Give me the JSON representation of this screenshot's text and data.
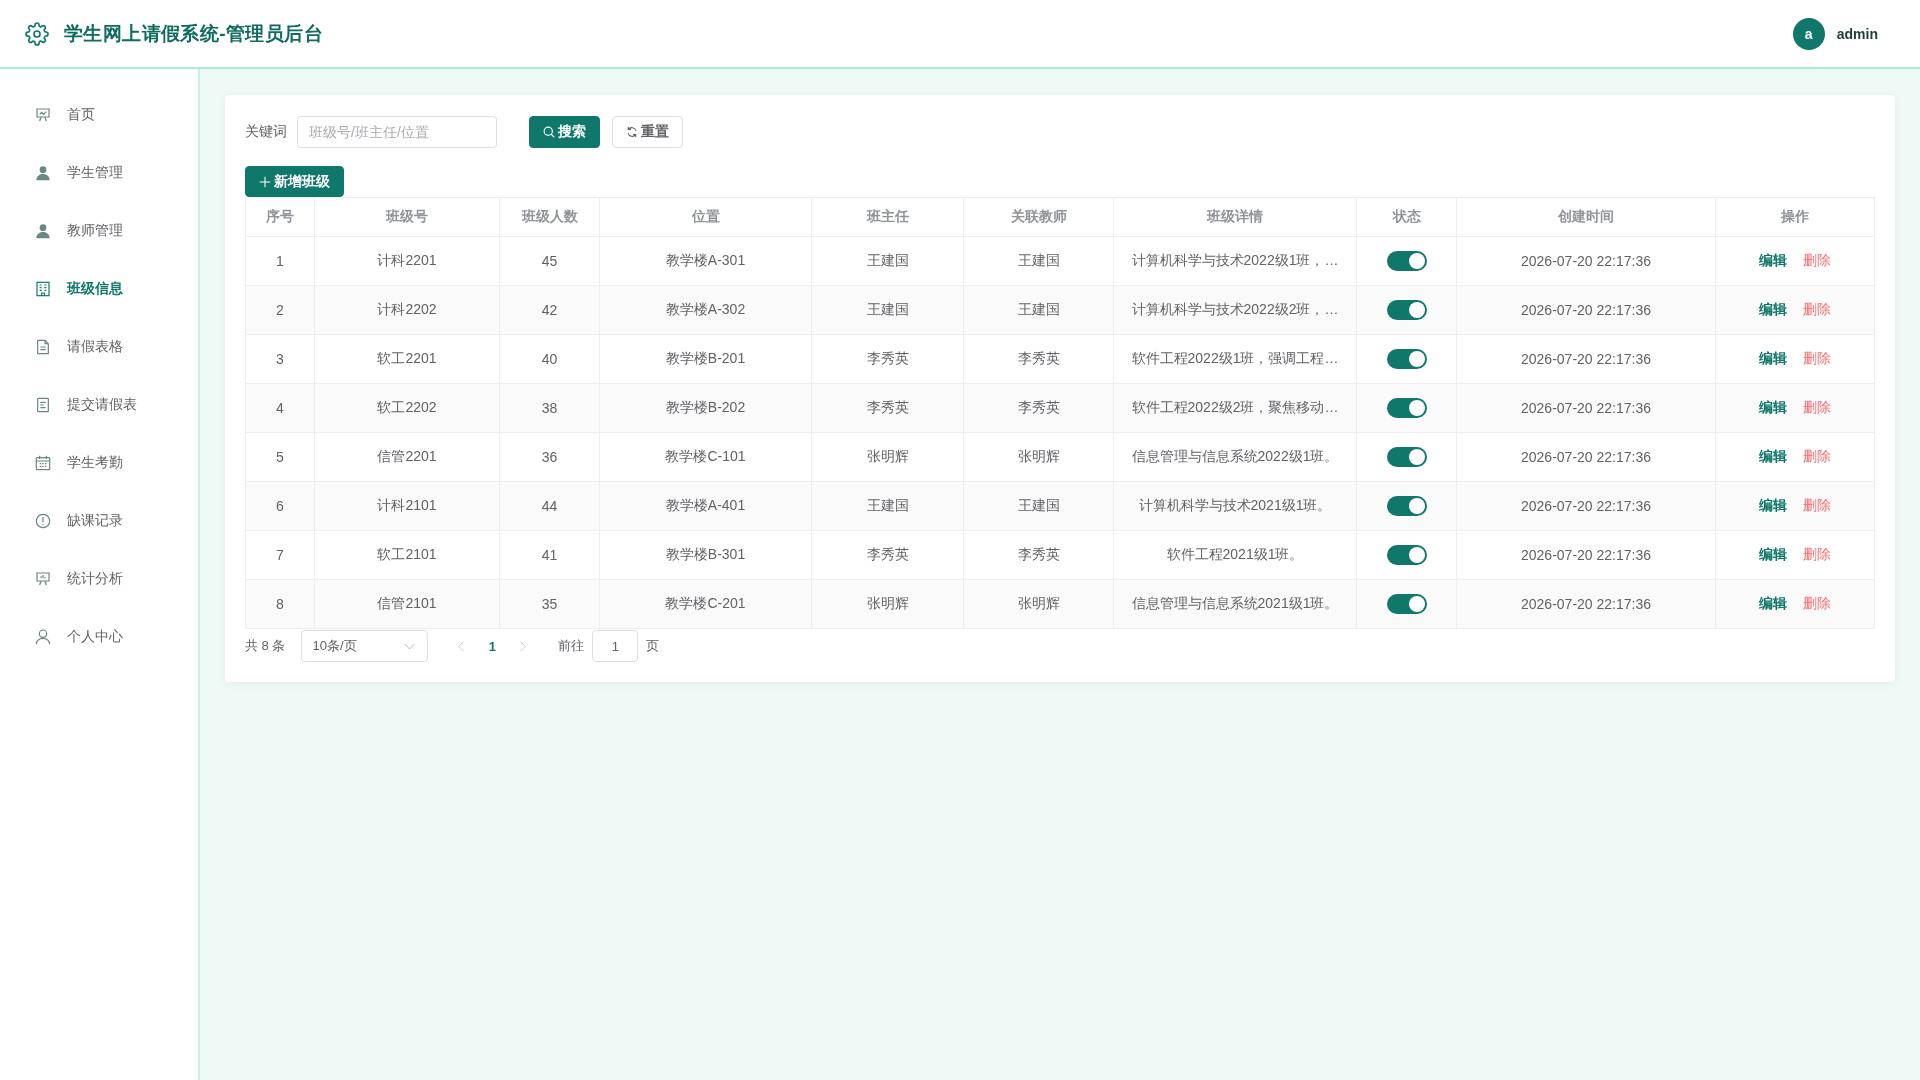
{
  "header": {
    "title": "学生网上请假系统-管理员后台",
    "user": {
      "avatar_letter": "a",
      "name": "admin"
    }
  },
  "sidebar": {
    "items": [
      {
        "label": "首页",
        "selected": false
      },
      {
        "label": "学生管理",
        "selected": false
      },
      {
        "label": "教师管理",
        "selected": false
      },
      {
        "label": "班级信息",
        "selected": true
      },
      {
        "label": "请假表格",
        "selected": false
      },
      {
        "label": "提交请假表",
        "selected": false
      },
      {
        "label": "学生考勤",
        "selected": false
      },
      {
        "label": "缺课记录",
        "selected": false
      },
      {
        "label": "统计分析",
        "selected": false
      },
      {
        "label": "个人中心",
        "selected": false
      }
    ]
  },
  "toolbar": {
    "keyword_label": "关键词",
    "search_field": {
      "placeholder": "班级号/班主任/位置"
    },
    "search_button": "搜索",
    "reset_button": "重置",
    "add_button": "新增班级"
  },
  "table": {
    "columns": [
      "序号",
      "班级号",
      "班级人数",
      "位置",
      "班主任",
      "关联教师",
      "班级详情",
      "状态",
      "创建时间",
      "操作"
    ],
    "rows": [
      {
        "index": "1",
        "class_no": "计科2201",
        "size": "45",
        "location": "教学楼A-301",
        "head_teacher": "王建国",
        "teacher": "王建国",
        "details": "计算机科学与技术2022级1班，…",
        "status_on": true,
        "created": "2026-07-20 22:17:36",
        "actions": [
          {
            "kind": "edit",
            "label": "编辑"
          },
          {
            "kind": "delete",
            "label": "删除"
          }
        ]
      },
      {
        "index": "2",
        "class_no": "计科2202",
        "size": "42",
        "location": "教学楼A-302",
        "head_teacher": "王建国",
        "teacher": "王建国",
        "details": "计算机科学与技术2022级2班，…",
        "status_on": true,
        "created": "2026-07-20 22:17:36",
        "actions": [
          {
            "kind": "edit",
            "label": "编辑"
          },
          {
            "kind": "delete",
            "label": "删除"
          }
        ]
      },
      {
        "index": "3",
        "class_no": "软工2201",
        "size": "40",
        "location": "教学楼B-201",
        "head_teacher": "李秀英",
        "teacher": "李秀英",
        "details": "软件工程2022级1班，强调工程…",
        "status_on": true,
        "created": "2026-07-20 22:17:36",
        "actions": [
          {
            "kind": "edit",
            "label": "编辑"
          },
          {
            "kind": "delete",
            "label": "删除"
          }
        ]
      },
      {
        "index": "4",
        "class_no": "软工2202",
        "size": "38",
        "location": "教学楼B-202",
        "head_teacher": "李秀英",
        "teacher": "李秀英",
        "details": "软件工程2022级2班，聚焦移动…",
        "status_on": true,
        "created": "2026-07-20 22:17:36",
        "actions": [
          {
            "kind": "edit",
            "label": "编辑"
          },
          {
            "kind": "delete",
            "label": "删除"
          }
        ]
      },
      {
        "index": "5",
        "class_no": "信管2201",
        "size": "36",
        "location": "教学楼C-101",
        "head_teacher": "张明辉",
        "teacher": "张明辉",
        "details": "信息管理与信息系统2022级1班。",
        "status_on": true,
        "created": "2026-07-20 22:17:36",
        "actions": [
          {
            "kind": "edit",
            "label": "编辑"
          },
          {
            "kind": "delete",
            "label": "删除"
          }
        ]
      },
      {
        "index": "6",
        "class_no": "计科2101",
        "size": "44",
        "location": "教学楼A-401",
        "head_teacher": "王建国",
        "teacher": "王建国",
        "details": "计算机科学与技术2021级1班。",
        "status_on": true,
        "created": "2026-07-20 22:17:36",
        "actions": [
          {
            "kind": "edit",
            "label": "编辑"
          },
          {
            "kind": "delete",
            "label": "删除"
          }
        ]
      },
      {
        "index": "7",
        "class_no": "软工2101",
        "size": "41",
        "location": "教学楼B-301",
        "head_teacher": "李秀英",
        "teacher": "李秀英",
        "details": "软件工程2021级1班。",
        "status_on": true,
        "created": "2026-07-20 22:17:36",
        "actions": [
          {
            "kind": "edit",
            "label": "编辑"
          },
          {
            "kind": "delete",
            "label": "删除"
          }
        ]
      },
      {
        "index": "8",
        "class_no": "信管2101",
        "size": "35",
        "location": "教学楼C-201",
        "head_teacher": "张明辉",
        "teacher": "张明辉",
        "details": "信息管理与信息系统2021级1班。",
        "status_on": true,
        "created": "2026-07-20 22:17:36",
        "actions": [
          {
            "kind": "edit",
            "label": "编辑"
          },
          {
            "kind": "delete",
            "label": "删除"
          }
        ]
      }
    ]
  },
  "pagination": {
    "total": "共 8 条",
    "page_size": "10条/页",
    "prev_button": {
      "disabled": true
    },
    "pages": [
      {
        "label": "1",
        "selected": true
      }
    ],
    "next_button": {
      "disabled": true
    },
    "goto_label": "前往",
    "goto_value": "1",
    "page_suffix": "页"
  }
}
